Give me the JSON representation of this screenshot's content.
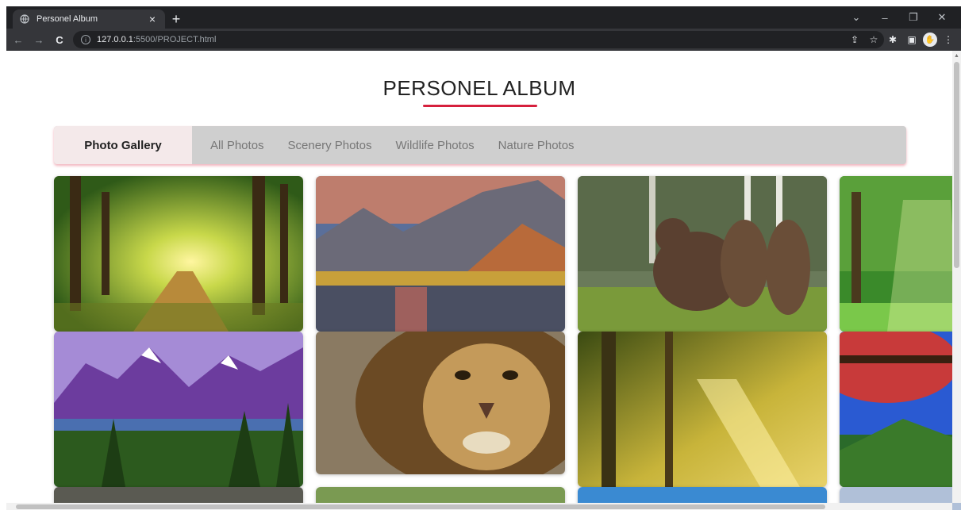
{
  "browser": {
    "tab_title": "Personel Album",
    "tab_close": "×",
    "new_tab": "+",
    "url_host": "127.0.0.1",
    "url_rest": ":5500/PROJECT.html",
    "controls": {
      "chevron": "⌄",
      "minimize": "–",
      "restore": "❐",
      "close": "✕"
    },
    "nav": {
      "back": "←",
      "forward": "→",
      "reload": "C"
    },
    "toolbar_icons": {
      "share": "⇪",
      "star": "☆",
      "extensions": "✱",
      "sidepanel": "▣",
      "profile": "✋",
      "menu": "⋮"
    }
  },
  "page": {
    "title": "PERSONEL ALBUM",
    "accent_color": "#d6203d",
    "navbar": {
      "brand": "Photo Gallery",
      "links": [
        "All Photos",
        "Scenery Photos",
        "Wildlife Photos",
        "Nature Photos"
      ]
    },
    "photos": [
      {
        "subject": "sunlit forest path"
      },
      {
        "subject": "mountain lake at sunset"
      },
      {
        "subject": "brown bears in meadow"
      },
      {
        "subject": "green forest with sun rays"
      },
      {
        "subject": "purple mountains with pine trees"
      },
      {
        "subject": "lion face close-up"
      },
      {
        "subject": "golden sunlit forest"
      },
      {
        "subject": "autumn tree over valley"
      }
    ]
  }
}
